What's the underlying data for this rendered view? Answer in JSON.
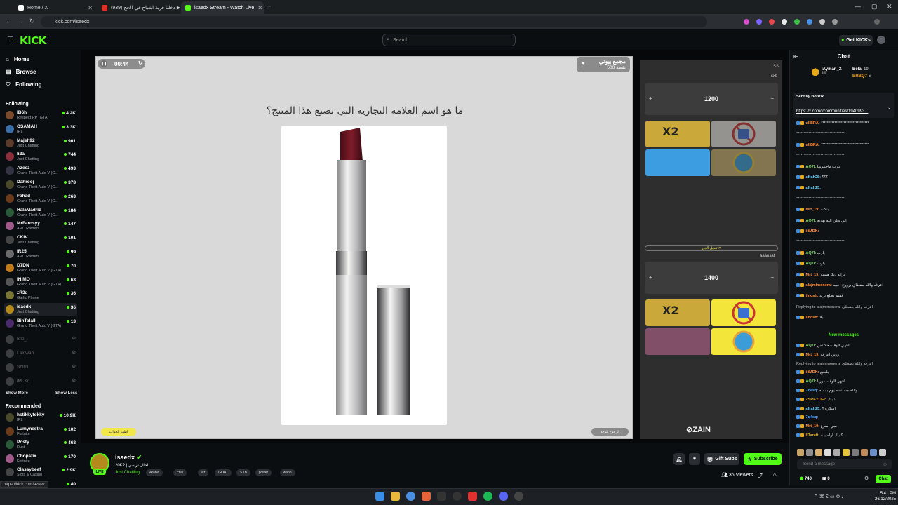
{
  "browser": {
    "tabs": [
      {
        "label": "Home / X"
      },
      {
        "label": "(939) دخلنا قرية اشباح في الحج ▶"
      },
      {
        "label": "isaedx Stream - Watch Live"
      }
    ],
    "url": "kick.com/isaedx"
  },
  "header": {
    "logo": "KICK",
    "search_placeholder": "Search",
    "get_kicks": "Get KICKs"
  },
  "sidebar": {
    "nav": [
      {
        "label": "Home"
      },
      {
        "label": "Browse"
      },
      {
        "label": "Following"
      }
    ],
    "following_title": "Following",
    "following": [
      {
        "name": "IB6h",
        "category": "Respect RP (GTA)",
        "viewers": "4.2K"
      },
      {
        "name": "OSAMAH",
        "category": "IRL",
        "viewers": "3.3K"
      },
      {
        "name": "Majeh92",
        "category": "Just Chatting",
        "viewers": "901"
      },
      {
        "name": "li2a",
        "category": "Just Chatting",
        "viewers": "744"
      },
      {
        "name": "Azeez",
        "category": "Grand Theft Auto V (G...",
        "viewers": "493"
      },
      {
        "name": "Dahrooj",
        "category": "Grand Theft Auto V (G...",
        "viewers": "378"
      },
      {
        "name": "Fahad",
        "category": "Grand Theft Auto V (G...",
        "viewers": "263"
      },
      {
        "name": "HalaMadrid",
        "category": "Grand Theft Auto V (G...",
        "viewers": "184"
      },
      {
        "name": "MrFarosyy",
        "category": "ARC Raiders",
        "viewers": "147"
      },
      {
        "name": "CKIV",
        "category": "Just Chatting",
        "viewers": "101"
      },
      {
        "name": "lR25",
        "category": "ARC Raiders",
        "viewers": "99"
      },
      {
        "name": "D7DN",
        "category": "Grand Theft Auto V (GTA)",
        "viewers": "70"
      },
      {
        "name": "iHIMO",
        "category": "Grand Theft Auto V (GTA)",
        "viewers": "63"
      },
      {
        "name": "zR3d",
        "category": "Garlic Phone",
        "viewers": "36"
      },
      {
        "name": "isaedx",
        "category": "Just Chatting",
        "viewers": "36"
      },
      {
        "name": "BinTalall",
        "category": "Grand Theft Auto V (GTA)",
        "viewers": "13"
      }
    ],
    "offline": [
      {
        "name": "Ielo_i"
      },
      {
        "name": "Lalowah"
      },
      {
        "name": "Sbltnl"
      },
      {
        "name": "iMLKq"
      }
    ],
    "show_more": "Show More",
    "show_less": "Show Less",
    "recommended_title": "Recommended",
    "recommended": [
      {
        "name": "hstikkytokky",
        "category": "IRL",
        "viewers": "10.9K"
      },
      {
        "name": "Lumynestra",
        "category": "Fortnite",
        "viewers": "102"
      },
      {
        "name": "Posty",
        "category": "Rust",
        "viewers": "468"
      },
      {
        "name": "Chopstix",
        "category": "Fortnite",
        "viewers": "170"
      },
      {
        "name": "Classybeef",
        "category": "Slots & Casino",
        "viewers": "2.9K"
      },
      {
        "name": "",
        "category": "",
        "viewers": "40"
      }
    ]
  },
  "stage": {
    "timer": "00:44",
    "badge_title": "مجمع بيوتي",
    "badge_points": "500 نقطة",
    "question": "ما هو اسم العلامة التجارية التي تصنع هذا المنتج؟",
    "left_button": "اظهر الجواب",
    "right_button": "الرجوع للوحة"
  },
  "quiz_panel": {
    "team1": {
      "label": "sxb",
      "score": "1200",
      "tag": "SS"
    },
    "team2": {
      "label": "aaansat",
      "score": "1400"
    },
    "change_turn": "تبديل الدور ✕",
    "x2_label": "X2",
    "zain": "ZAIN"
  },
  "stream": {
    "name": "isaedx",
    "title": "20K? | احلل ترسي",
    "category": "Just Chatting",
    "tags": [
      "Arabic",
      "chill",
      "ez",
      "GOAT",
      "SXB",
      "power",
      "wano"
    ],
    "gift_subs": "Gift Subs",
    "subscribe": "Subscribe",
    "viewers": "36 Viewers"
  },
  "chat": {
    "title": "Chat",
    "leaders": [
      {
        "name": "iAyman_X",
        "count": "10"
      },
      {
        "name": "Belal",
        "count": "10"
      },
      {
        "name": "BRBQ7",
        "count": "5"
      }
    ],
    "pinned_by": "Sent by BotRix",
    "pinned_text": "https://x.com/i/communities/1940993...",
    "messages": [
      {
        "user": "ullBRA:",
        "text": "********************************"
      },
      {
        "user": "",
        "text": "********************************"
      },
      {
        "user": "ullBRA:",
        "text": "********************************"
      },
      {
        "user": "",
        "text": "********************************"
      },
      {
        "user": "AQ7l:",
        "text": "يارب ماجيبونها"
      },
      {
        "user": "afrah25:",
        "text": "؟؟؟"
      },
      {
        "user": "afrah25:",
        "text": ""
      },
      {
        "user": "",
        "text": "********************************"
      },
      {
        "user": "Mrt_19:",
        "text": "بنكت"
      },
      {
        "user": "AQ7l:",
        "text": "الي يعلن الله يهديه"
      },
      {
        "user": "iiiMDK:",
        "text": ""
      },
      {
        "user": "",
        "text": "********************************"
      },
      {
        "user": "AQ7l:",
        "text": "يارب"
      },
      {
        "user": "AQ7l:",
        "text": "يارب"
      },
      {
        "user": "Mrt_19:",
        "text": "براند ديكا همبيه"
      },
      {
        "user": "alajmimonera:",
        "text": "اعرفه والله بضطاي برورج احبيه"
      },
      {
        "user": "ilnosh:",
        "text": "قسم بطلع برند"
      },
      {
        "user": "",
        "text": "Replying to alajmimonera: اعرفه والله بضطاي"
      },
      {
        "user": "ilnosh:",
        "text": "بلا"
      }
    ],
    "new_messages": "New messages",
    "messages2": [
      {
        "user": "AQ7l:",
        "text": "انتهي الوقت حكلتس"
      },
      {
        "user": "Mrt_19:",
        "text": "وربي اعرفه"
      },
      {
        "user": "",
        "text": "Replying to alajmimonera: اعرفه والله بضطاي"
      },
      {
        "user": "iiiMDK:",
        "text": "بلبعبع"
      },
      {
        "user": "AQ7l:",
        "text": "انتهي الوقت دوريا"
      },
      {
        "user": "7q4sq:",
        "text": "والله مشانسه يوم بمسه"
      },
      {
        "user": "2SREYOFI:",
        "text": "ثابتك"
      },
      {
        "user": "afrah25:",
        "text": "اشكرة ؟"
      },
      {
        "user": "7q4sq:",
        "text": ""
      },
      {
        "user": "Mrt_19:",
        "text": "مبي اسرع"
      },
      {
        "user": "IITaraft:",
        "text": "كابيك اولسيت"
      }
    ],
    "send_placeholder": "Send a message",
    "points": "740",
    "other_count": "0",
    "chat_button": "Chat"
  },
  "status_url": "https://kick.com/azeez",
  "clock": {
    "time": "5:41 PM",
    "date": "26/12/2025"
  },
  "colors": {
    "accent": "#53fc18",
    "background": "#0b0e11"
  }
}
